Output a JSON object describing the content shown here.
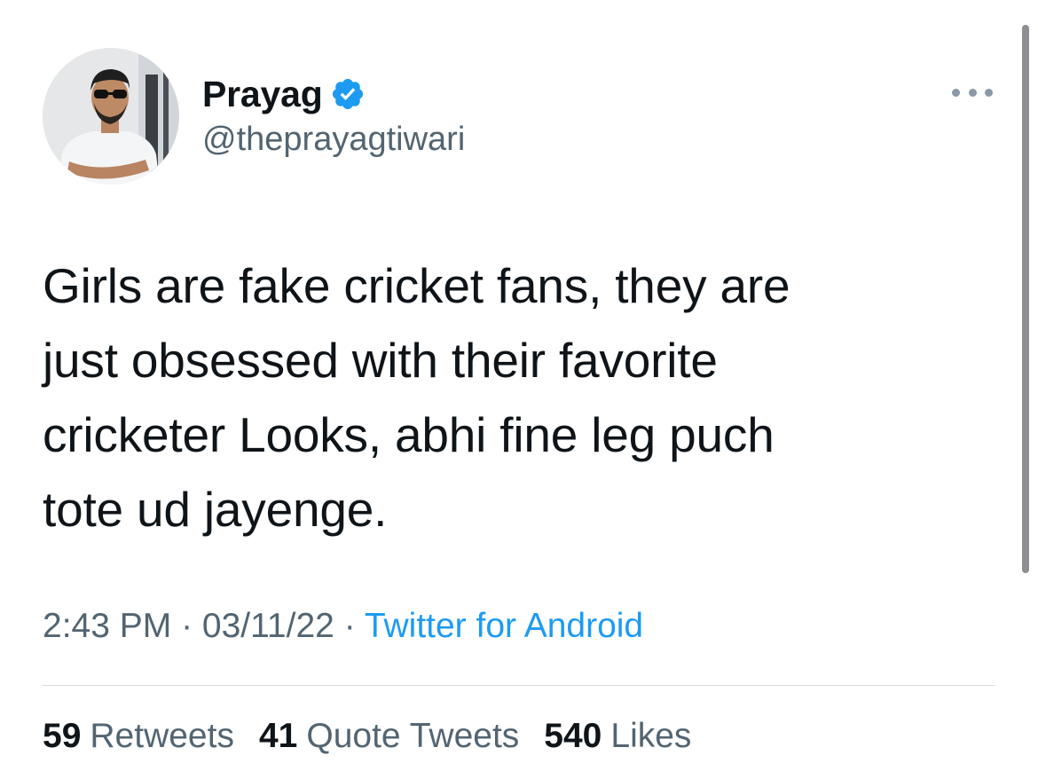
{
  "tweet": {
    "author": {
      "display_name": "Prayag",
      "handle": "@theprayagtiwari",
      "verified": true
    },
    "text": "Girls are fake cricket fans, they are\njust obsessed with their favorite\ncricketer Looks, abhi fine leg puch\ntote ud jayenge.",
    "time": "2:43 PM",
    "separator": "·",
    "date": "03/11/22",
    "source": "Twitter for Android",
    "stats": {
      "retweets": {
        "count": "59",
        "label": "Retweets"
      },
      "quote_tweets": {
        "count": "41",
        "label": "Quote Tweets"
      },
      "likes": {
        "count": "540",
        "label": "Likes"
      }
    }
  },
  "icons": {
    "verified": "verified-badge-icon",
    "more": "more-options-icon"
  },
  "colors": {
    "text": "#0f1419",
    "secondary": "#536471",
    "accent": "#1d9bf0",
    "verified": "#1d9bf0"
  }
}
